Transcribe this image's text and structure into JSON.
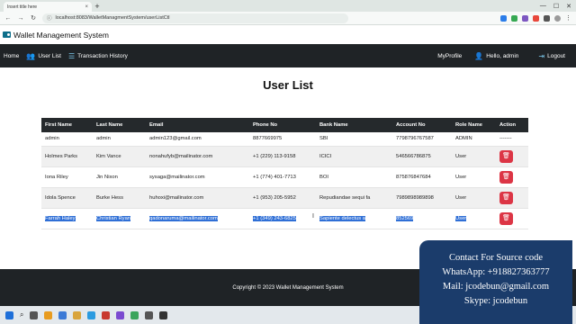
{
  "browser": {
    "tab_title": "Insert title here",
    "tab_close": "×",
    "new_tab": "+",
    "url": "localhost:8083/WalletManagmentSystem/userListCtl",
    "win_min": "—",
    "win_max": "☐",
    "win_close": "✕"
  },
  "app": {
    "brand": "Wallet Management System"
  },
  "nav": {
    "home": "Home",
    "user_list": "User List",
    "transactions": "Transaction History",
    "my_profile": "MyProfile",
    "hello": "Hello, admin",
    "logout": "Logout"
  },
  "page_title": "User List",
  "table": {
    "headers": [
      "First Name",
      "Last Name",
      "Email",
      "Phone No",
      "Bank Name",
      "Account No",
      "Role Name",
      "Action"
    ],
    "rows": [
      [
        "admin",
        "admin",
        "admin123@gmail.com",
        "8877669975",
        "SBI",
        "7798796767587",
        "ADMIN",
        "-------"
      ],
      [
        "Holmes Parks",
        "Kim Vance",
        "nonahufyb@mailinator.com",
        "+1 (229) 113-9158",
        "ICICI",
        "546566786875",
        "User",
        ""
      ],
      [
        "Iona Riley",
        "Jin Nixon",
        "sysaga@mailinator.com",
        "+1 (774) 401-7713",
        "BOI",
        "875876847684",
        "User",
        ""
      ],
      [
        "Idola Spence",
        "Burke Hess",
        "huhoxi@mailinator.com",
        "+1 (953) 205-5952",
        "Repudiandae sequi fa",
        "7989898989898",
        "User",
        ""
      ],
      [
        "Farrah Haley",
        "Christian Ryan",
        "qadonaruma@mailinator.com",
        "+1 (349) 243-6825",
        "Sapiente delectus a",
        "852569",
        "User",
        ""
      ]
    ],
    "delete_icon": "🗑"
  },
  "footer": "Copyright © 2023 Wallet Management System",
  "overlay": {
    "line1": "Contact For Source code",
    "line2": "WhatsApp:   +918827363777",
    "line3": "Mail: jcodebun@gmail.com",
    "line4": "Skype: jcodebun"
  },
  "colors": {
    "nav_bg": "#1f2326",
    "delete_btn": "#dc3545",
    "selection": "#2f6fd6",
    "overlay_bg": "#1b3c6b"
  }
}
